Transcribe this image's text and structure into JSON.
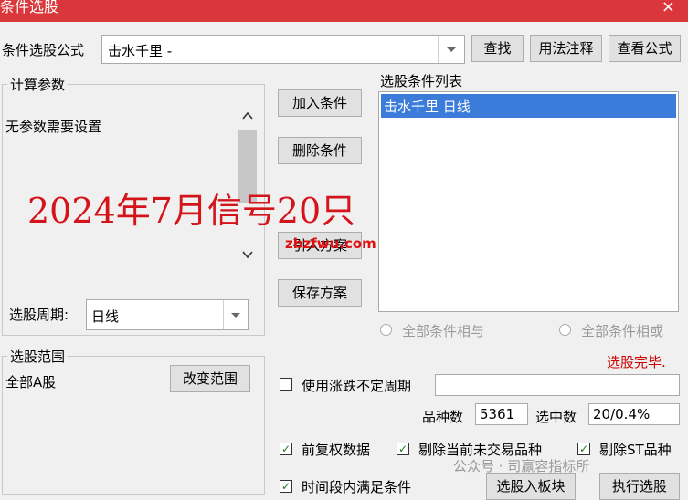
{
  "window": {
    "title": "条件选股",
    "close_glyph": "×"
  },
  "formula": {
    "label": "条件选股公式",
    "value": "击水千里  -"
  },
  "buttons": {
    "find": "查找",
    "usage": "用法注释",
    "view_formula": "查看公式",
    "add_condition": "加入条件",
    "delete_condition": "删除条件",
    "import_plan": "引入方案",
    "save_plan": "保存方案",
    "change_range": "改变范围",
    "to_block": "选股入板块",
    "execute": "执行选股"
  },
  "params": {
    "legend": "计算参数",
    "message": "无参数需要设置"
  },
  "overlay": {
    "big_text": "2024年7月信号20只",
    "watermark": "zbzfwu.com"
  },
  "period": {
    "label": "选股周期:",
    "value": "日线"
  },
  "conditions": {
    "legend": "选股条件列表",
    "items": [
      "击水千里  日线"
    ]
  },
  "logic": {
    "and": "全部条件相与",
    "or": "全部条件相或"
  },
  "status": {
    "text": "选股完毕.",
    "color": "#cc0000"
  },
  "scope": {
    "legend": "选股范围",
    "value": "全部A股"
  },
  "options": {
    "uncertain_period": "使用涨跌不定周期",
    "pre_adjusted": "前复权数据",
    "remove_not_traded": "剔除当前未交易品种",
    "remove_st": "剔除ST品种",
    "time_period": "时间段内满足条件"
  },
  "stats": {
    "count_label": "品种数",
    "count_value": "5361",
    "selected_label": "选中数",
    "selected_value": "20/0.4%"
  },
  "footer_watermark": "公众号 · 司赢容指标所",
  "colors": {
    "title_bar": "#d9373b",
    "selection": "#3b7bd9",
    "overlay_text": "#d4141b"
  }
}
